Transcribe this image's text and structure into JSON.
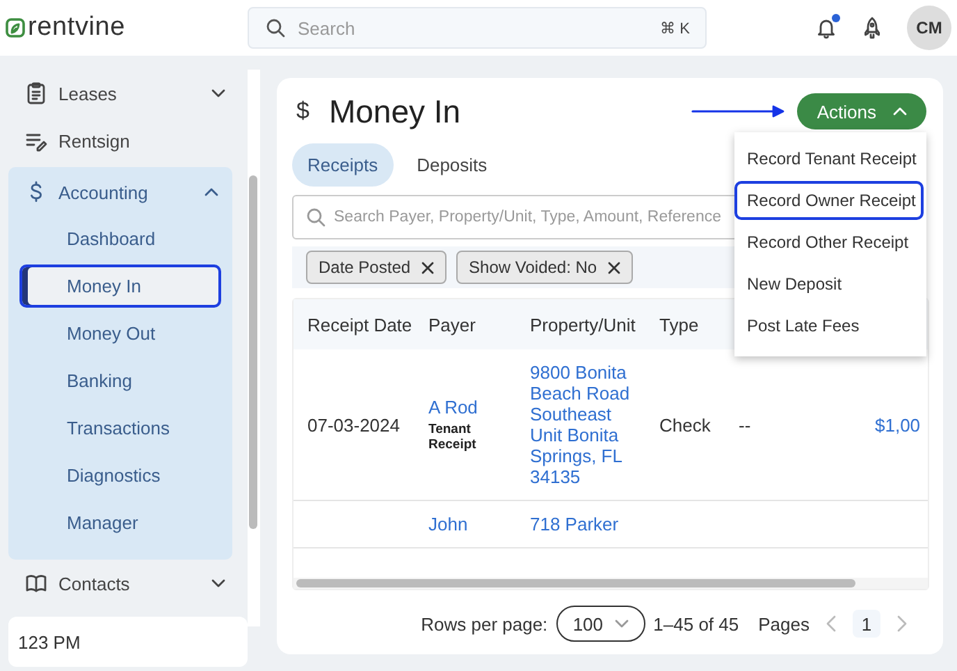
{
  "brand": {
    "name": "rentvine"
  },
  "search": {
    "placeholder": "Search",
    "shortcut": "⌘ K"
  },
  "header": {
    "notifications_unread": true,
    "avatar": "CM"
  },
  "sidebar": {
    "items": [
      {
        "label": "Leases",
        "kind": "group",
        "expanded": false
      },
      {
        "label": "Rentsign",
        "kind": "link"
      },
      {
        "label": "Accounting",
        "kind": "group",
        "expanded": true,
        "children": [
          {
            "label": "Dashboard",
            "selected": false
          },
          {
            "label": "Money In",
            "selected": true
          },
          {
            "label": "Money Out",
            "selected": false
          },
          {
            "label": "Banking",
            "selected": false
          },
          {
            "label": "Transactions",
            "selected": false
          },
          {
            "label": "Diagnostics",
            "selected": false
          },
          {
            "label": "Manager",
            "selected": false
          }
        ]
      },
      {
        "label": "Contacts",
        "kind": "group",
        "expanded": false
      }
    ],
    "footer": "123 PM"
  },
  "page": {
    "icon": "$",
    "title": "Money In",
    "actions": {
      "label": "Actions",
      "expanded": true,
      "items": [
        {
          "label": "Record Tenant Receipt",
          "selected": false
        },
        {
          "label": "Record Owner Receipt",
          "selected": true
        },
        {
          "label": "Record Other Receipt",
          "selected": false
        },
        {
          "label": "New Deposit",
          "selected": false
        },
        {
          "label": "Post Late Fees",
          "selected": false
        }
      ]
    },
    "tabs": [
      {
        "label": "Receipts",
        "selected": true
      },
      {
        "label": "Deposits",
        "selected": false
      }
    ],
    "search": {
      "placeholder": "Search Payer, Property/Unit, Type, Amount, Reference"
    },
    "filters": [
      "Date Posted",
      "Show Voided: No"
    ],
    "table": {
      "columns": [
        "Receipt Date",
        "Payer",
        "Property/Unit",
        "Type"
      ],
      "rows": [
        {
          "date": "07-03-2024",
          "payer": "A Rod",
          "payer_note": "Tenant Receipt",
          "property": "9800 Bonita Beach Road Southeast Unit Bonita Springs, FL 34135",
          "type": "Check",
          "column_5": "--",
          "column_6": "$1,00"
        },
        {
          "payer": "John",
          "property": "718 Parker"
        }
      ]
    },
    "pagination": {
      "rows_label": "Rows per page:",
      "rows_per_page": "100",
      "range": "1–45 of 45",
      "pages_label": "Pages",
      "pages": [
        {
          "label": "1",
          "selected": true
        }
      ]
    }
  }
}
